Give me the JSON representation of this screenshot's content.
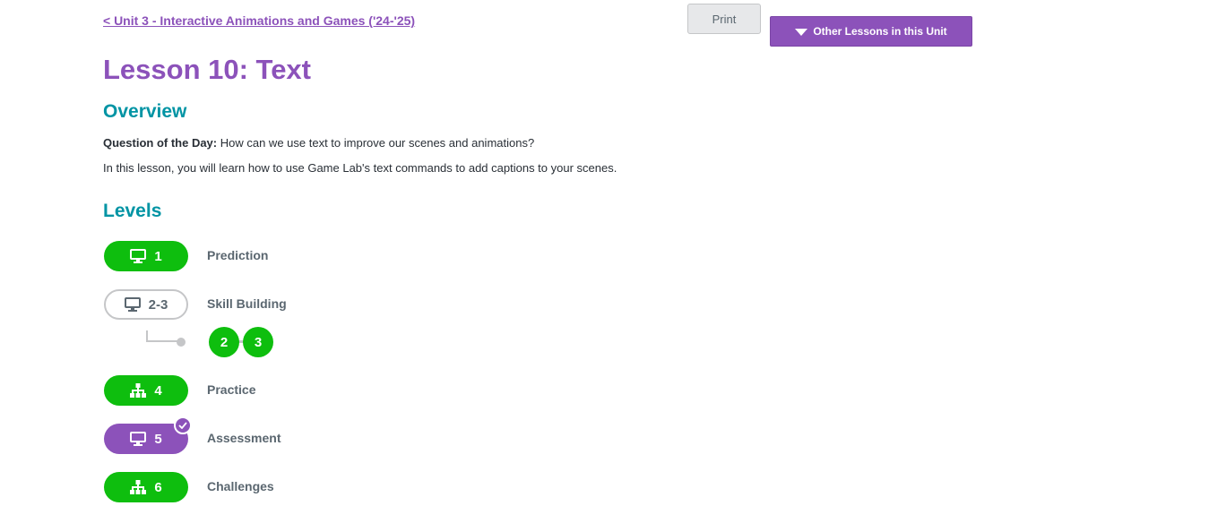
{
  "header": {
    "back_link": "< Unit 3 - Interactive Animations and Games ('24-'25)",
    "print_label": "Print",
    "other_lessons_label": "Other Lessons in this Unit"
  },
  "lesson": {
    "title": "Lesson 10: Text",
    "overview_heading": "Overview",
    "qotd_label": "Question of the Day:",
    "qotd_text": " How can we use text to improve our scenes and animations?",
    "description": "In this lesson, you will learn how to use Game Lab's text commands to add captions to your scenes."
  },
  "levels": {
    "heading": "Levels",
    "items": [
      {
        "number": "1",
        "label": "Prediction",
        "icon": "monitor-icon",
        "status": "completed"
      },
      {
        "number": "2-3",
        "label": "Skill Building",
        "icon": "monitor-icon",
        "status": "not-started"
      },
      {
        "number": "4",
        "label": "Practice",
        "icon": "sitemap-icon",
        "status": "completed"
      },
      {
        "number": "5",
        "label": "Assessment",
        "icon": "monitor-icon",
        "status": "assessment-submitted"
      },
      {
        "number": "6",
        "label": "Challenges",
        "icon": "sitemap-icon",
        "status": "completed"
      }
    ],
    "sublevels": [
      "2",
      "3"
    ]
  },
  "colors": {
    "purple": "#8c52ba",
    "teal": "#0094a4",
    "green": "#0ebe0e",
    "gray": "#5b6770",
    "light_gray": "#c5c6c8"
  }
}
